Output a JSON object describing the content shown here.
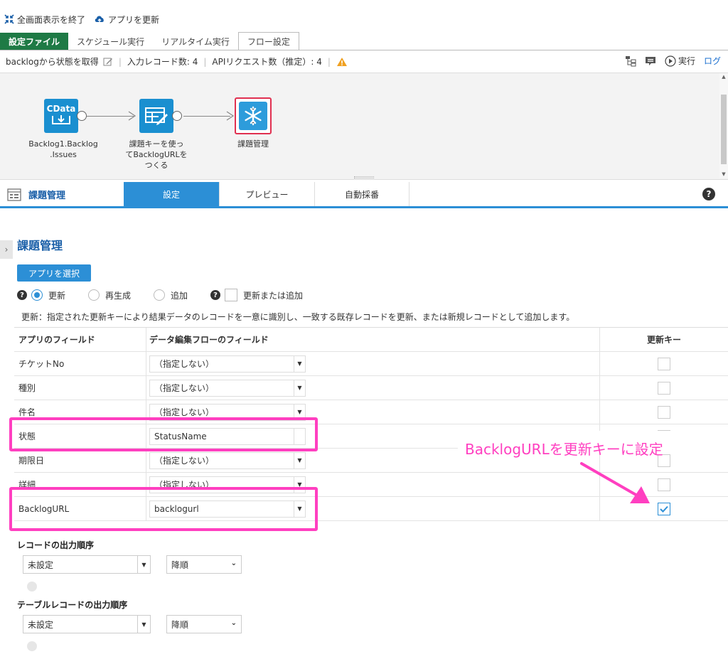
{
  "topbar": {
    "exit_fullscreen": "全画面表示を終了",
    "update_app": "アプリを更新"
  },
  "tabs": [
    "設定ファイル",
    "スケジュール実行",
    "リアルタイム実行",
    "フロー設定"
  ],
  "flowbar": {
    "flow_name": "backlogから状態を取得",
    "input_records": "入力レコード数: 4",
    "api_requests": "APIリクエスト数（推定）: 4",
    "run_label": "実行",
    "log_label": "ログ"
  },
  "nodes": [
    {
      "icon_text": "CData",
      "label_lines": [
        "Backlog1.Backlog",
        ".Issues"
      ]
    },
    {
      "label_lines": [
        "課題キーを使っ",
        "てBacklogURLを",
        "つくる"
      ]
    },
    {
      "label_lines": [
        "課題管理"
      ]
    }
  ],
  "panel": {
    "title": "課題管理",
    "tabs": [
      "設定",
      "プレビュー",
      "自動採番"
    ],
    "help": "?"
  },
  "content": {
    "title": "課題管理",
    "select_app_button": "アプリを選択",
    "modes": [
      "更新",
      "再生成",
      "追加"
    ],
    "upsert_label": "更新または追加",
    "description": "更新：指定された更新キーにより結果データのレコードを一意に識別し、一致する既存レコードを更新、または新規レコードとして追加します。"
  },
  "table": {
    "headers": [
      "アプリのフィールド",
      "データ編集フローのフィールド",
      "更新キー"
    ],
    "rows": [
      {
        "app_field": "チケットNo",
        "flow_field": "（指定しない）",
        "key": false
      },
      {
        "app_field": "種別",
        "flow_field": "（指定しない）",
        "key": false
      },
      {
        "app_field": "件名",
        "flow_field": "（指定しない）",
        "key": false
      },
      {
        "app_field": "状態",
        "flow_field": "StatusName",
        "key": false
      },
      {
        "app_field": "期限日",
        "flow_field": "（指定しない）",
        "key": false
      },
      {
        "app_field": "詳細",
        "flow_field": "（指定しない）",
        "key": false
      },
      {
        "app_field": "BacklogURL",
        "flow_field": "backlogurl",
        "key": true
      }
    ]
  },
  "annotation": "BacklogURLを更新キーに設定",
  "record_order": {
    "title": "レコードの出力順序",
    "field": "未設定",
    "direction": "降順"
  },
  "table_record_order": {
    "title": "テーブルレコードの出力順序",
    "field": "未設定",
    "direction": "降順"
  },
  "colors": {
    "accent": "#2c8fd6",
    "highlight": "#ff3fc0",
    "brand_green": "#1e7a45"
  }
}
